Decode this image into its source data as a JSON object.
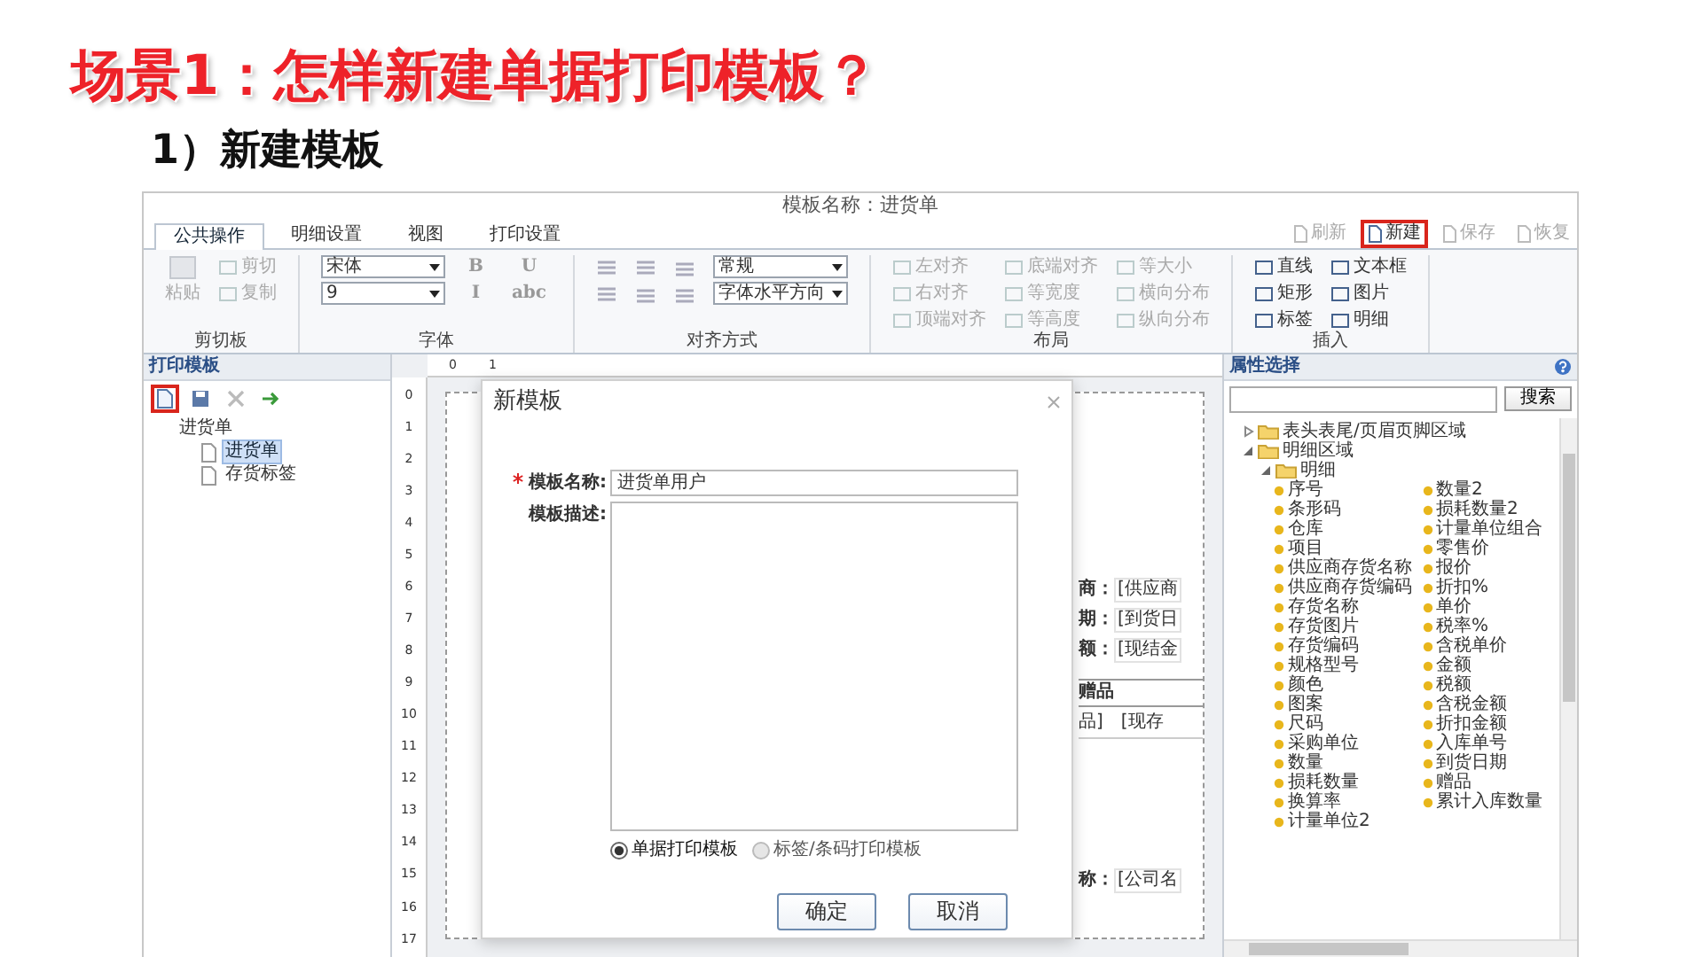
{
  "slide": {
    "title": "场景1：怎样新建单据打印模板？",
    "subtitle": "1）新建模板"
  },
  "app": {
    "template_name": "模板名称：进货单",
    "tabs": [
      {
        "label": "公共操作",
        "selected": true
      },
      {
        "label": "明细设置",
        "selected": false
      },
      {
        "label": "视图",
        "selected": false
      },
      {
        "label": "打印设置",
        "selected": false
      }
    ],
    "top_actions": [
      {
        "label": "刷新",
        "disabled": true,
        "highlighted": false
      },
      {
        "label": "新建",
        "disabled": false,
        "highlighted": true
      },
      {
        "label": "保存",
        "disabled": true,
        "highlighted": false
      },
      {
        "label": "恢复",
        "disabled": true,
        "highlighted": false
      }
    ],
    "ribbon": [
      {
        "kind": "clipboard",
        "title": "剪切板",
        "controls": [
          {
            "kind": "big",
            "label": "粘贴",
            "disabled": true
          },
          {
            "kind": "tool",
            "label": "剪切",
            "disabled": true
          },
          {
            "kind": "tool",
            "label": "复制",
            "disabled": true
          }
        ]
      },
      {
        "kind": "font",
        "title": "字体",
        "controls": [
          {
            "kind": "select",
            "label": "宋体"
          },
          {
            "kind": "select",
            "label": "9"
          },
          {
            "kind": "format",
            "label": "B"
          },
          {
            "kind": "format",
            "label": "I"
          },
          {
            "kind": "format",
            "label": "U"
          },
          {
            "kind": "format",
            "label": "abc"
          }
        ]
      },
      {
        "kind": "align",
        "title": "对齐方式",
        "controls": [
          {
            "kind": "select",
            "label": "常规"
          },
          {
            "kind": "select",
            "label": "字体水平方向"
          }
        ]
      },
      {
        "kind": "layout",
        "title": "布局",
        "controls": [
          {
            "kind": "tool",
            "label": "左对齐",
            "disabled": true
          },
          {
            "kind": "tool",
            "label": "右对齐",
            "disabled": true
          },
          {
            "kind": "tool",
            "label": "顶端对齐",
            "disabled": true
          },
          {
            "kind": "tool",
            "label": "底端对齐",
            "disabled": true
          },
          {
            "kind": "tool",
            "label": "等宽度",
            "disabled": true
          },
          {
            "kind": "tool",
            "label": "等高度",
            "disabled": true
          },
          {
            "kind": "tool",
            "label": "等大小",
            "disabled": true
          },
          {
            "kind": "tool",
            "label": "横向分布",
            "disabled": true
          },
          {
            "kind": "tool",
            "label": "纵向分布",
            "disabled": true
          }
        ]
      },
      {
        "kind": "insert",
        "title": "插入",
        "controls": [
          {
            "kind": "tool",
            "label": "直线",
            "disabled": false
          },
          {
            "kind": "tool",
            "label": "矩形",
            "disabled": false
          },
          {
            "kind": "tool",
            "label": "标签",
            "disabled": false
          },
          {
            "kind": "tool",
            "label": "文本框",
            "disabled": false
          },
          {
            "kind": "tool",
            "label": "图片",
            "disabled": false
          },
          {
            "kind": "tool",
            "label": "明细",
            "disabled": false
          }
        ]
      }
    ],
    "left_panel": {
      "title": "打印模板",
      "toolbar": [
        {
          "kind": "new",
          "highlighted": true
        },
        {
          "kind": "save",
          "highlighted": false
        },
        {
          "kind": "delete",
          "highlighted": false
        },
        {
          "kind": "move",
          "highlighted": false
        }
      ],
      "tree": [
        {
          "label": "进货单",
          "children": [
            {
              "label": "进货单",
              "selected": true
            },
            {
              "label": "存货标签",
              "selected": false
            }
          ]
        }
      ]
    },
    "canvas": {
      "ruler_horizontal": [
        "0",
        "1"
      ],
      "ruler_vertical": [
        "0",
        "1",
        "2",
        "3",
        "4",
        "5",
        "6",
        "7",
        "8",
        "9",
        "10",
        "11",
        "12",
        "13",
        "14",
        "15",
        "16",
        "17"
      ],
      "fields": [
        {
          "label": "商：",
          "value": "[供应商"
        },
        {
          "label": "期：",
          "value": "[到货日"
        },
        {
          "label": "额：",
          "value": "[现结金"
        }
      ],
      "detail_header": "赠品",
      "detail_cells": [
        "品]",
        "[现存"
      ],
      "footer_field": {
        "label": "称：",
        "value": "[公司名"
      }
    },
    "properties": {
      "title": "属性选择",
      "search_button": "搜索",
      "tree": [
        {
          "label": "表头表尾/页眉页脚区域",
          "expanded": false
        },
        {
          "label": "明细区域",
          "expanded": true,
          "children": [
            {
              "label": "明细",
              "expanded": true,
              "children": [
                {
                  "label": "序号"
                },
                {
                  "label": "条形码"
                },
                {
                  "label": "仓库"
                },
                {
                  "label": "项目"
                },
                {
                  "label": "供应商存货名称"
                },
                {
                  "label": "供应商存货编码"
                },
                {
                  "label": "存货名称"
                },
                {
                  "label": "存货图片"
                },
                {
                  "label": "存货编码"
                },
                {
                  "label": "规格型号"
                },
                {
                  "label": "颜色"
                },
                {
                  "label": "图案"
                },
                {
                  "label": "尺码"
                },
                {
                  "label": "采购单位"
                },
                {
                  "label": "数量"
                },
                {
                  "label": "损耗数量"
                },
                {
                  "label": "换算率"
                },
                {
                  "label": "计量单位2"
                },
                {
                  "label": "数量2"
                },
                {
                  "label": "损耗数量2"
                },
                {
                  "label": "计量单位组合"
                },
                {
                  "label": "零售价"
                },
                {
                  "label": "报价"
                },
                {
                  "label": "折扣%"
                },
                {
                  "label": "单价"
                },
                {
                  "label": "税率%"
                },
                {
                  "label": "含税单价"
                },
                {
                  "label": "金额"
                },
                {
                  "label": "税额"
                },
                {
                  "label": "含税金额"
                },
                {
                  "label": "折扣金额"
                },
                {
                  "label": "入库单号"
                },
                {
                  "label": "到货日期"
                },
                {
                  "label": "赠品"
                },
                {
                  "label": "累计入库数量"
                }
              ]
            }
          ]
        }
      ]
    }
  },
  "dialog": {
    "title": "新模板",
    "fields": [
      {
        "kind": "input",
        "label": "模板名称:",
        "required": true,
        "value": "进货单用户"
      },
      {
        "kind": "textarea",
        "label": "模板描述:",
        "required": false
      }
    ],
    "options": [
      {
        "label": "单据打印模板",
        "selected": true
      },
      {
        "label": "标签/条码打印模板",
        "selected": false
      }
    ],
    "buttons": [
      "确定",
      "取消"
    ]
  }
}
